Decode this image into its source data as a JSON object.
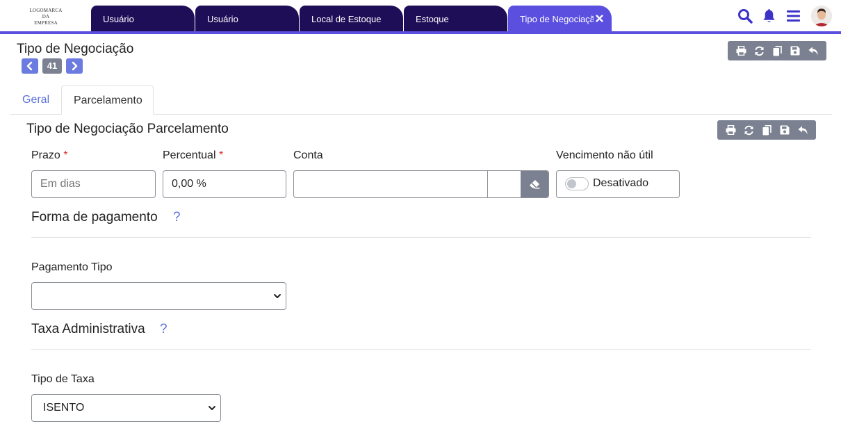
{
  "app": {
    "logo_lines": [
      "LOGOMARCA",
      "DA",
      "EMPRESA"
    ]
  },
  "tabs": [
    {
      "label": "Usuário",
      "active": false
    },
    {
      "label": "Usuário",
      "active": false
    },
    {
      "label": "Local de Estoque",
      "active": false
    },
    {
      "label": "Estoque",
      "active": false
    },
    {
      "label": "Tipo de Negociação",
      "active": true
    }
  ],
  "header_icons": [
    "search-icon",
    "bell-icon",
    "menu-icon",
    "avatar"
  ],
  "page": {
    "title": "Tipo de Negociação",
    "record_number": "41"
  },
  "toolbar_icons": [
    "print-icon",
    "refresh-icon",
    "copy-icon",
    "save-icon",
    "undo-icon"
  ],
  "subtabs": [
    {
      "label": "Geral",
      "active": false
    },
    {
      "label": "Parcelamento",
      "active": true
    }
  ],
  "section": {
    "title": "Tipo de Negociação Parcelamento"
  },
  "fields": {
    "prazo": {
      "label": "Prazo",
      "required_mark": "*",
      "placeholder": "Em dias",
      "value": ""
    },
    "percentual": {
      "label": "Percentual",
      "required_mark": "*",
      "value": "0,00 %"
    },
    "conta": {
      "label": "Conta",
      "value": ""
    },
    "vencimento": {
      "label": "Vencimento não útil",
      "toggle_text": "Desativado",
      "enabled": false
    }
  },
  "forma_pagamento": {
    "title": "Forma de pagamento",
    "help": "?",
    "pagamento_tipo": {
      "label": "Pagamento Tipo",
      "selected": ""
    }
  },
  "taxa_administrativa": {
    "title": "Taxa Administrativa",
    "help": "?",
    "tipo_taxa": {
      "label": "Tipo de Taxa",
      "selected": "ISENTO"
    }
  },
  "colors": {
    "primary_dark": "#1e0e57",
    "accent": "#5b4fe0",
    "link": "#5b73d9",
    "toolbar_gray": "#7b8190",
    "required": "#d9302c"
  }
}
